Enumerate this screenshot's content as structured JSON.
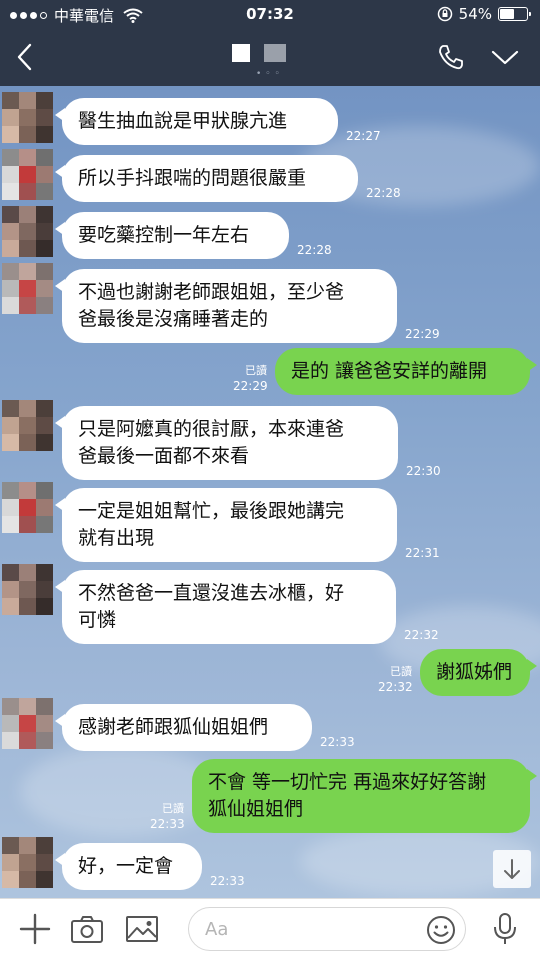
{
  "status_bar": {
    "carrier": "中華電信",
    "time": "07:32",
    "battery": "54%",
    "battery_level": 0.54
  },
  "header": {
    "back_icon": "chevron-left-icon",
    "call_icon": "phone-icon",
    "menu_icon": "chevron-down-icon"
  },
  "messages": [
    {
      "dir": "in",
      "lines": [
        "醫生抽血說是甲狀腺亢進"
      ],
      "time": "22:27"
    },
    {
      "dir": "in",
      "lines": [
        "所以手抖跟喘的問題很嚴重"
      ],
      "time": "22:28"
    },
    {
      "dir": "in",
      "lines": [
        "要吃藥控制一年左右"
      ],
      "time": "22:28"
    },
    {
      "dir": "in",
      "lines": [
        "不過也謝謝老師跟姐姐，至少爸",
        "爸最後是沒痛睡著走的"
      ],
      "time": "22:29"
    },
    {
      "dir": "out",
      "lines": [
        "是的 讓爸爸安詳的離開"
      ],
      "time": "22:29",
      "read": "已讀"
    },
    {
      "dir": "in",
      "lines": [
        "只是阿嬤真的很討厭，本來連爸",
        "爸最後一面都不來看"
      ],
      "time": "22:30"
    },
    {
      "dir": "in",
      "lines": [
        "一定是姐姐幫忙，最後跟她講完",
        "就有出現"
      ],
      "time": "22:31"
    },
    {
      "dir": "in",
      "lines": [
        "不然爸爸一直還沒進去冰櫃，好",
        "可憐"
      ],
      "time": "22:32"
    },
    {
      "dir": "out",
      "lines": [
        "謝狐姊們"
      ],
      "time": "22:32",
      "read": "已讀"
    },
    {
      "dir": "in",
      "lines": [
        "感謝老師跟狐仙姐姐們"
      ],
      "time": "22:33"
    },
    {
      "dir": "out",
      "lines": [
        "不會 等一切忙完 再過來好好答謝",
        "狐仙姐姐們"
      ],
      "time": "22:33",
      "read": "已讀"
    },
    {
      "dir": "in",
      "lines": [
        "好，一定會"
      ],
      "time": "22:33"
    }
  ],
  "input_bar": {
    "placeholder": "Aa",
    "icons": [
      "plus-icon",
      "camera-icon",
      "image-icon",
      "emoji-icon",
      "microphone-icon"
    ]
  },
  "scroll_button": {
    "icon": "arrow-down-icon"
  }
}
